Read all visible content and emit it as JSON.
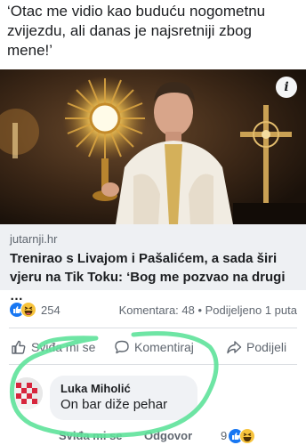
{
  "post": {
    "text": "‘Otac me vidio kao buduću nogometnu zvijezdu, ali danas je najsretniji zbog mene!’"
  },
  "link_preview": {
    "domain": "jutarnji.hr",
    "title": "Trenirao s Livajom i Pašalićem, a sada širi vjeru na Tik Toku: ‘Bog me pozvao na drugi …",
    "info_badge": "i"
  },
  "stats": {
    "reaction_icons": [
      "like-icon",
      "haha-icon"
    ],
    "reaction_count": "254",
    "comments_shares": "Komentara: 48 • Podijeljeno 1 puta"
  },
  "actions": {
    "like_label": "Sviđa mi se",
    "comment_label": "Komentiraj",
    "share_label": "Podijeli"
  },
  "comment": {
    "author": "Luka Miholić",
    "text": "On bar diže pehar",
    "like_label": "Sviđa mi se",
    "reply_label": "Odgovor",
    "reaction_count": "9",
    "reaction_icons": [
      "like-icon",
      "haha-icon"
    ]
  },
  "colors": {
    "accent": "#1877f2",
    "highlight": "#5ee29a",
    "muted_text": "#606770"
  }
}
